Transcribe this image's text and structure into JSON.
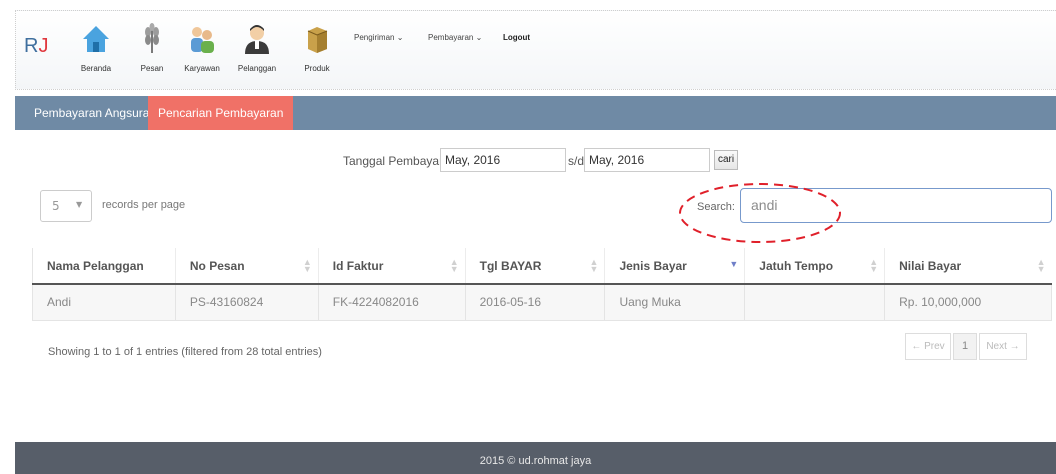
{
  "brand": {
    "letters": "R",
    "accent": "J"
  },
  "nav": [
    {
      "label": "Beranda",
      "icon": "home-icon"
    },
    {
      "label": "Pesan",
      "icon": "wheat-icon"
    },
    {
      "label": "Karyawan",
      "icon": "employees-icon"
    },
    {
      "label": "Pelanggan",
      "icon": "customer-icon"
    },
    {
      "label": "Produk",
      "icon": "box-icon"
    }
  ],
  "menu": {
    "pengiriman": "Pengiriman ⌄",
    "pembayaran": "Pembayaran ⌄",
    "logout": "Logout"
  },
  "tabs": [
    {
      "label": "Pembayaran Angsuran",
      "active": false
    },
    {
      "label": "Pencarian Pembayaran",
      "active": true
    }
  ],
  "filter": {
    "label": "Tanggal Pembayaran:",
    "from": "May, 2016",
    "sd": "s/d",
    "to": "May, 2016",
    "button": "cari"
  },
  "perpage": {
    "value": "5",
    "caret": "▼",
    "label": "records per page"
  },
  "search": {
    "label": "Search:",
    "value": "andi"
  },
  "table": {
    "headers": [
      "Nama Pelanggan",
      "No Pesan",
      "Id Faktur",
      "Tgl BAYAR",
      "Jenis Bayar",
      "Jatuh Tempo",
      "Nilai Bayar"
    ],
    "rows": [
      [
        "Andi",
        "PS-43160824",
        "FK-4224082016",
        "2016-05-16",
        "Uang Muka",
        "",
        "Rp. 10,000,000"
      ]
    ]
  },
  "info": "Showing 1 to 1 of 1 entries (filtered from 28 total entries)",
  "pagination": {
    "prev": "← Prev",
    "page": "1",
    "next": "Next →"
  },
  "footer": "2015 © ud.rohmat jaya",
  "colors": {
    "tabbar": "#6f8aa5",
    "active_tab": "#f07167",
    "footer": "#575e69",
    "annotation": "#e0202a"
  }
}
